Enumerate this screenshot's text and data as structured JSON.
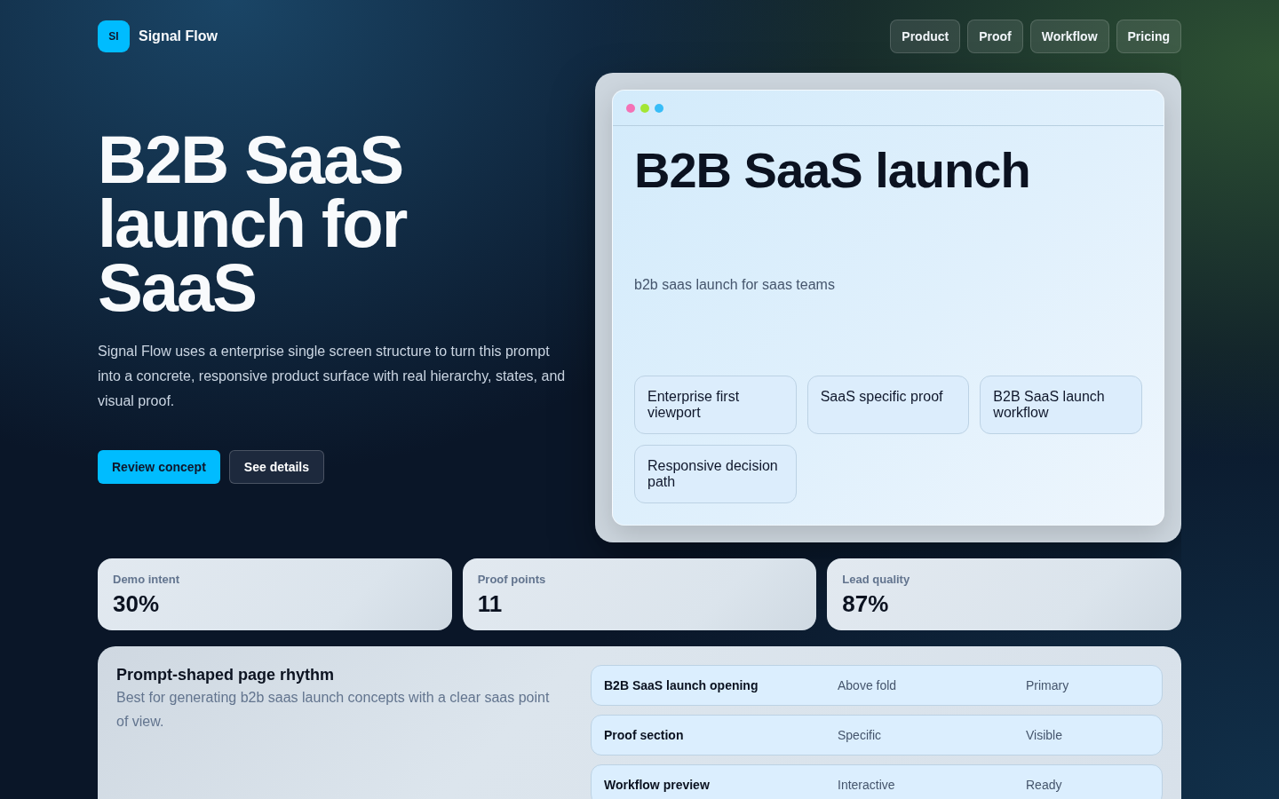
{
  "brand": {
    "mark": "SI",
    "name": "Signal Flow"
  },
  "nav": [
    "Product",
    "Proof",
    "Workflow",
    "Pricing"
  ],
  "hero": {
    "title": "B2B SaaS launch for SaaS",
    "description": "Signal Flow uses a enterprise single screen structure to turn this prompt into a concrete, responsive product surface with real hierarchy, states, and visual proof.",
    "buttons": [
      {
        "label": "Review concept",
        "kind": "primary"
      },
      {
        "label": "See details",
        "kind": "secondary"
      }
    ]
  },
  "preview": {
    "title": "B2B SaaS launch",
    "subtitle": "b2b saas launch for saas teams",
    "chips": [
      "Enterprise first viewport",
      "SaaS specific proof",
      "B2B SaaS launch workflow",
      "Responsive decision path"
    ]
  },
  "stats": [
    {
      "label": "Demo intent",
      "value": "30%"
    },
    {
      "label": "Proof points",
      "value": "11"
    },
    {
      "label": "Lead quality",
      "value": "87%"
    }
  ],
  "rhythm": {
    "title": "Prompt-shaped page rhythm",
    "description": "Best for generating b2b saas launch concepts with a clear saas point of view.",
    "rows": [
      {
        "cells": [
          "B2B SaaS launch opening",
          "Above fold",
          "Primary"
        ]
      },
      {
        "cells": [
          "Proof section",
          "Specific",
          "Visible"
        ]
      },
      {
        "cells": [
          "Workflow preview",
          "Interactive",
          "Ready"
        ]
      }
    ]
  }
}
